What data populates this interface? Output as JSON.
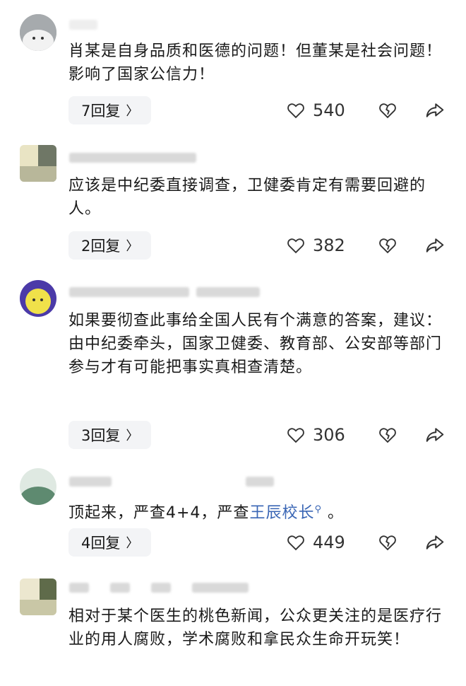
{
  "comments": [
    {
      "text": "肖某是自身品质和医德的问题！但董某是社会问题！影响了国家公信力！",
      "reply": "7回复",
      "likes": "540"
    },
    {
      "text": "应该是中纪委直接调查，卫健委肯定有需要回避的人。",
      "reply": "2回复",
      "likes": "382"
    },
    {
      "text": "如果要彻查此事给全国人民有个满意的答案，建议：由中纪委牵头，国家卫健委、教育部、公安部等部门参与才有可能把事实真相查清楚。",
      "reply": "3回复",
      "likes": "306"
    },
    {
      "text_before": "顶起来，严查4+4，严查",
      "link": "王辰校长",
      "text_after": "。",
      "reply": "4回复",
      "likes": "449"
    },
    {
      "text": "相对于某个医生的桃色新闻，公众更关注的是医疗行业的用人腐败，学术腐败和拿民众生命开玩笑！"
    }
  ],
  "icons": {
    "like": "heart-outline-icon",
    "dislike": "broken-heart-icon",
    "share": "share-arrow-icon",
    "reply_chevron": "chevron-right-icon",
    "link_marker": "search-icon"
  },
  "colors": {
    "link": "#3a66b5",
    "reply_bg": "#f3f4f6"
  }
}
